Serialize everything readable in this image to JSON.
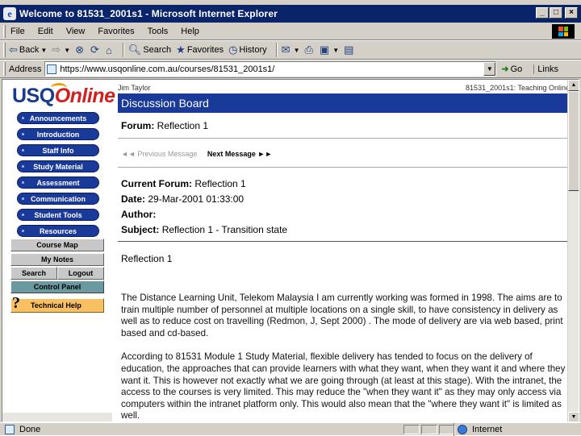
{
  "window": {
    "title": "Welcome to 81531_2001s1 - Microsoft Internet Explorer",
    "buttons": {
      "minimize": "_",
      "maximize": "□",
      "close": "×"
    }
  },
  "menu": [
    "File",
    "Edit",
    "View",
    "Favorites",
    "Tools",
    "Help"
  ],
  "toolbar": {
    "back": "Back",
    "search": "Search",
    "favorites": "Favorites",
    "history": "History"
  },
  "address": {
    "label": "Address",
    "url": "https://www.usqonline.com.au/courses/81531_2001s1/",
    "go": "Go",
    "links": "Links"
  },
  "sidebar": {
    "logo_usq": "USQ",
    "logo_online": "Online",
    "nav_items": [
      "Announcements",
      "Introduction",
      "Staff Info",
      "Study Material",
      "Assessment",
      "Communication",
      "Student Tools",
      "Resources"
    ],
    "course_map": "Course Map",
    "my_notes": "My Notes",
    "search": "Search",
    "logout": "Logout",
    "control_panel": "Control Panel",
    "help": "Technical Help",
    "help_icon": "?"
  },
  "main": {
    "user_name": "Jim Taylor",
    "course_role": "81531_2001s1: Teaching Online",
    "banner": "Discussion Board",
    "forum_label": "Forum:",
    "forum_name": "Reflection 1",
    "prev_message": "◄◄ Previous Message",
    "next_message": "Next Message ►►",
    "current_forum_label": "Current Forum:",
    "current_forum": "Reflection 1",
    "date_label": "Date:",
    "date": "29-Mar-2001 01:33:00",
    "author_label": "Author:",
    "subject_label": "Subject:",
    "subject": "Reflection 1 - Transition state",
    "message_title": "Reflection 1",
    "paragraphs": [
      "The Distance Learning Unit, Telekom Malaysia I am currently working was formed in 1998. The aims are to train multiple number of personnel at multiple locations on a single skill, to have consistency in delivery as well as to reduce cost on travelling (Redmon, J, Sept 2000) . The mode of delivery are via web based, print based and cd-based.",
      "According to 81531 Module 1 Study Material, flexible delivery has tended to focus on the delivery of education, the approaches that can provide learners with what they want, when they want it and where they want it. This is however not exactly what we are going through (at least at this stage). With the intranet, the access to the courses is very limited. This may reduce the \"when they want it\" as they may only access via computers within the intranet platform only. This would also mean that the \"where they want it\" is limited as well."
    ]
  },
  "status": {
    "text": "Done",
    "zone": "Internet"
  }
}
